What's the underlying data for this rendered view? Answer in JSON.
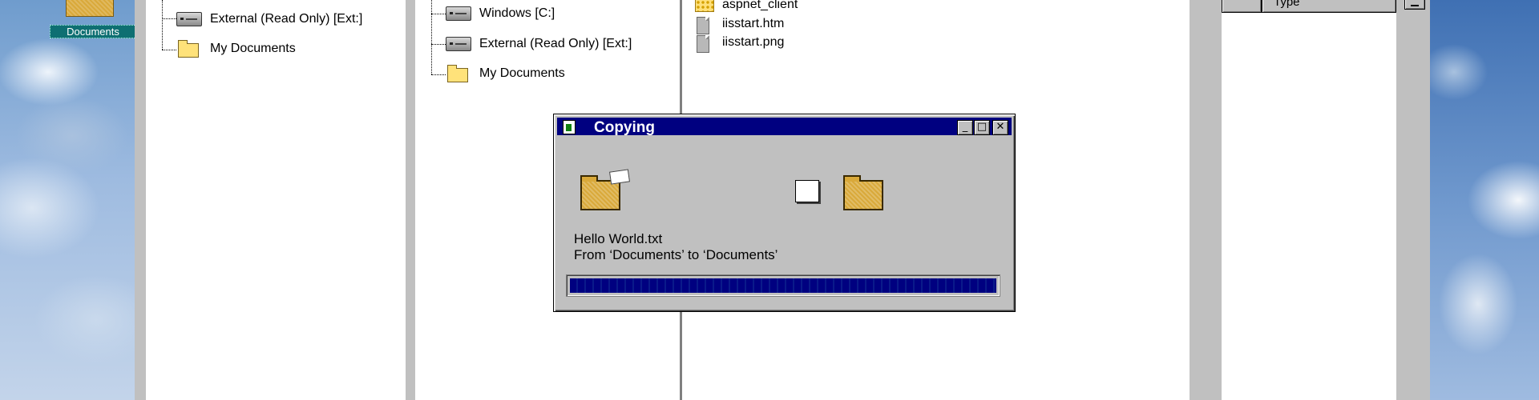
{
  "desktop": {
    "icon_label": "Documents"
  },
  "left_tree": {
    "items": [
      {
        "label": "External (Read Only) [Ext:]",
        "icon": "drive-icon"
      },
      {
        "label": "My Documents",
        "icon": "folder-icon"
      }
    ]
  },
  "middle_tree": {
    "items": [
      {
        "label": "Windows [C:]",
        "icon": "drive-icon"
      },
      {
        "label": "External (Read Only) [Ext:]",
        "icon": "drive-icon"
      },
      {
        "label": "My Documents",
        "icon": "folder-icon"
      }
    ]
  },
  "file_list": {
    "items": [
      {
        "label": "aspnet_client",
        "icon": "system-folder-icon"
      },
      {
        "label": "iisstart.htm",
        "icon": "document-icon"
      },
      {
        "label": "iisstart.png",
        "icon": "document-icon"
      }
    ]
  },
  "right_panel": {
    "column_header": "Type"
  },
  "dialog": {
    "title": "Copying",
    "minimize_glyph": "_",
    "maximize_glyph": "□",
    "close_glyph": "✕",
    "file_name": "Hello World.txt",
    "from_to": "From ‘Documents’ to ‘Documents’",
    "progress": 1.0
  },
  "colors": {
    "titlebar": "#000080",
    "progress": "#000080",
    "face": "#c0c0c0"
  }
}
